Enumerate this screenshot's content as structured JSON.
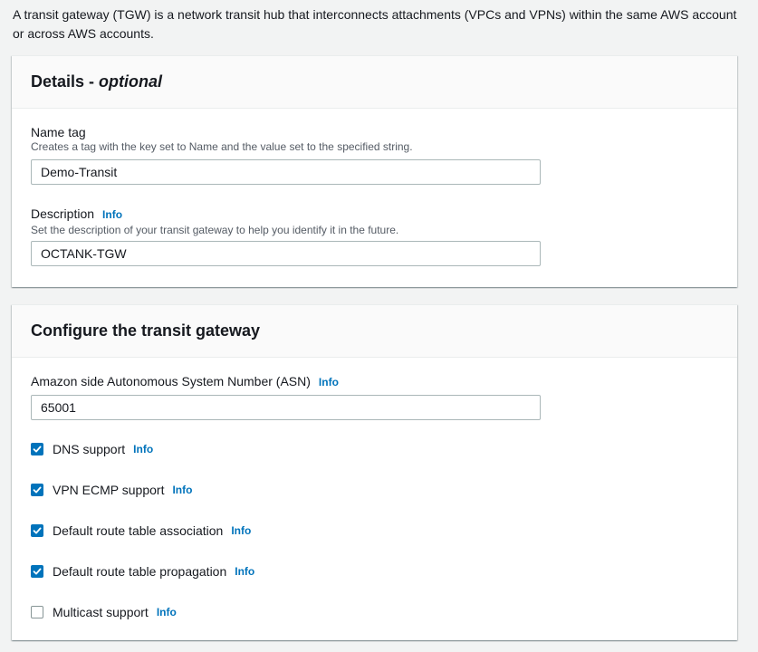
{
  "intro_text": "A transit gateway (TGW) is a network transit hub that interconnects attachments (VPCs and VPNs) within the same AWS account or across AWS accounts.",
  "details": {
    "title": "Details - ",
    "title_optional": "optional",
    "name_tag": {
      "label": "Name tag",
      "description": "Creates a tag with the key set to Name and the value set to the specified string.",
      "value": "Demo-Transit"
    },
    "description_field": {
      "label": "Description",
      "info": "Info",
      "description": "Set the description of your transit gateway to help you identify it in the future.",
      "value": "OCTANK-TGW"
    }
  },
  "configure": {
    "title": "Configure the transit gateway",
    "asn": {
      "label": "Amazon side Autonomous System Number (ASN)",
      "info": "Info",
      "value": "65001"
    },
    "options": [
      {
        "label": "DNS support",
        "info": "Info",
        "checked": true
      },
      {
        "label": "VPN ECMP support",
        "info": "Info",
        "checked": true
      },
      {
        "label": "Default route table association",
        "info": "Info",
        "checked": true
      },
      {
        "label": "Default route table propagation",
        "info": "Info",
        "checked": true
      },
      {
        "label": "Multicast support",
        "info": "Info",
        "checked": false
      }
    ]
  },
  "colors": {
    "accent": "#0073bb",
    "background": "#f2f3f3",
    "border": "#aab7b8"
  }
}
